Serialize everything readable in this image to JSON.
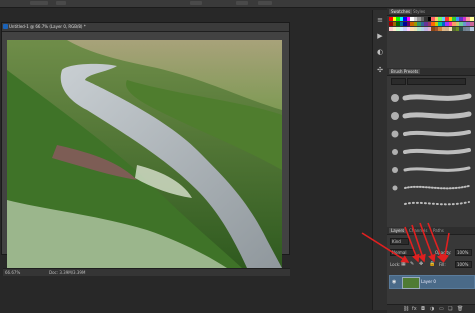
{
  "document": {
    "title": "Untitled-1 @ 66.7% (Layer 0, RGB/8) *",
    "zoom": "66.67%",
    "doc_size": "Doc: 3.39M/3.39M"
  },
  "colors": {
    "ps_blue": "#1b63b9",
    "selected_layer": "#4a6a88",
    "arrow_red": "#e02020"
  },
  "tools": [
    {
      "icon": "history-icon",
      "glyph": "≡"
    },
    {
      "icon": "actions-icon",
      "glyph": "▶"
    },
    {
      "icon": "adjustments-icon",
      "glyph": "◐"
    },
    {
      "icon": "transform-icon",
      "glyph": "✣"
    }
  ],
  "swatches_panel": {
    "tabs": [
      "Swatches",
      "Styles"
    ],
    "colors": [
      "#ff0000",
      "#ffff00",
      "#00ff00",
      "#00ffff",
      "#0000ff",
      "#ff00ff",
      "#ffffff",
      "#cccccc",
      "#999999",
      "#666666",
      "#333333",
      "#000000",
      "#ff6666",
      "#ffcc66",
      "#66ff66",
      "#66ccff",
      "#ff3333",
      "#ffcc00",
      "#33cc33",
      "#3399ff",
      "#6633cc",
      "#cc33cc",
      "#ff9999",
      "#ffff99",
      "#990000",
      "#996600",
      "#006600",
      "#006699",
      "#000099",
      "#660066",
      "#cc6600",
      "#999900",
      "#339966",
      "#336699",
      "#663399",
      "#993366",
      "#ff6600",
      "#cccc00",
      "#00cc99",
      "#0066cc",
      "#9933ff",
      "#ff3399",
      "#ff9966",
      "#cccc66",
      "#66cc99",
      "#6699cc",
      "#9966cc",
      "#cc6699",
      "#ffcccc",
      "#ffeecc",
      "#ccffcc",
      "#cceeff",
      "#ccccff",
      "#ffccff",
      "#ffe0b3",
      "#e6e6b3",
      "#b3e6cc",
      "#b3d1e6",
      "#c2b3e6",
      "#e6b3d1",
      "#8b4513",
      "#a0522d",
      "#cd853f",
      "#deb887",
      "#d2b48c",
      "#f5deb3",
      "#556b2f",
      "#6b8e23",
      "#2f4f4f",
      "#708090",
      "#778899",
      "#b0c4de"
    ]
  },
  "brush_presets": {
    "title": "Brush Presets"
  },
  "layers_panel": {
    "tabs": [
      "Layers",
      "Channels",
      "Paths"
    ],
    "kind_filter": "Kind",
    "blend_mode": "Normal",
    "opacity_label": "Opacity:",
    "opacity_value": "100%",
    "lock_label": "Lock:",
    "fill_label": "Fill:",
    "fill_value": "100%",
    "layer_name": "Layer 0",
    "footer_icons": [
      "link-icon",
      "fx-icon",
      "mask-icon",
      "adjustment-layer-icon",
      "group-icon",
      "new-layer-icon",
      "trash-icon"
    ]
  }
}
